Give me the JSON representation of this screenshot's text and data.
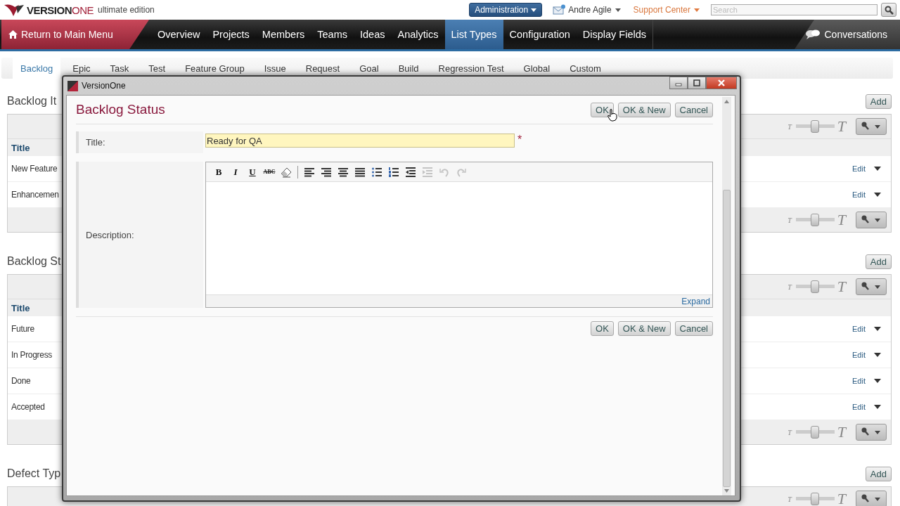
{
  "header": {
    "logo": {
      "brand_main": "VERSION",
      "brand_accent": "ONE",
      "edition": "ultimate edition"
    },
    "admin_menu": "Administration",
    "user": "Andre Agile",
    "support": "Support Center",
    "search": {
      "placeholder": "Search"
    }
  },
  "nav": {
    "return": "Return to Main Menu",
    "items": [
      {
        "label": "Overview",
        "selected": false
      },
      {
        "label": "Projects",
        "selected": false
      },
      {
        "label": "Members",
        "selected": false
      },
      {
        "label": "Teams",
        "selected": false
      },
      {
        "label": "Ideas",
        "selected": false
      },
      {
        "label": "Analytics",
        "selected": false
      },
      {
        "label": "List Types",
        "selected": true
      },
      {
        "label": "Configuration",
        "selected": false
      },
      {
        "label": "Display Fields",
        "selected": false
      }
    ],
    "conversations": "Conversations"
  },
  "subtabs": [
    {
      "label": "Backlog",
      "selected": true
    },
    {
      "label": "Epic",
      "selected": false
    },
    {
      "label": "Task",
      "selected": false
    },
    {
      "label": "Test",
      "selected": false
    },
    {
      "label": "Feature Group",
      "selected": false
    },
    {
      "label": "Issue",
      "selected": false
    },
    {
      "label": "Request",
      "selected": false
    },
    {
      "label": "Goal",
      "selected": false
    },
    {
      "label": "Build",
      "selected": false
    },
    {
      "label": "Regression Test",
      "selected": false
    },
    {
      "label": "Global",
      "selected": false
    },
    {
      "label": "Custom",
      "selected": false
    }
  ],
  "sections": [
    {
      "title": "Backlog It",
      "add": "Add",
      "toolbar_top": {
        "small": "T",
        "large": "T",
        "level": 0.5
      },
      "column": "Title",
      "rows": [
        {
          "title": "New Feature",
          "edit": "Edit"
        },
        {
          "title": "Enhancemen",
          "edit": "Edit"
        }
      ],
      "toolbar_bottom": {
        "small": "T",
        "large": "T",
        "level": 0.5
      }
    },
    {
      "title": "Backlog St",
      "add": "Add",
      "toolbar_top": {
        "small": "T",
        "large": "T",
        "level": 0.5
      },
      "column": "Title",
      "rows": [
        {
          "title": "Future",
          "edit": "Edit"
        },
        {
          "title": "In Progress",
          "edit": "Edit"
        },
        {
          "title": "Done",
          "edit": "Edit"
        },
        {
          "title": "Accepted",
          "edit": "Edit"
        }
      ],
      "toolbar_bottom": {
        "small": "T",
        "large": "T",
        "level": 0.5
      }
    },
    {
      "title": "Defect Typ",
      "add": "Add",
      "toolbar_top": {
        "small": "T",
        "large": "T",
        "level": 0.5
      }
    }
  ],
  "dialog": {
    "window_title": "VersionOne",
    "heading": "Backlog Status",
    "buttons": [
      "OK",
      "OK & New",
      "Cancel"
    ],
    "title_field": {
      "label": "Title:",
      "value": "Ready for QA",
      "required_mark": "*"
    },
    "description": {
      "label": "Description:",
      "expand": "Expand",
      "format_buttons": [
        {
          "kind": "bold",
          "label": "B",
          "disabled": false
        },
        {
          "kind": "italic",
          "label": "I",
          "disabled": false
        },
        {
          "kind": "underline",
          "label": "U",
          "disabled": false
        },
        {
          "kind": "strike",
          "label": "ABC",
          "disabled": false
        },
        {
          "kind": "eraser",
          "disabled": false
        }
      ],
      "paragraph_buttons": [
        {
          "kind": "align-left",
          "disabled": false
        },
        {
          "kind": "align-right",
          "disabled": false
        },
        {
          "kind": "align-center",
          "disabled": false
        },
        {
          "kind": "justify",
          "disabled": false
        },
        {
          "kind": "bullet-list",
          "disabled": false
        },
        {
          "kind": "numbered-list",
          "disabled": false
        },
        {
          "kind": "outdent",
          "disabled": false
        },
        {
          "kind": "indent",
          "disabled": true
        },
        {
          "kind": "undo",
          "disabled": true
        },
        {
          "kind": "redo",
          "disabled": true
        }
      ]
    },
    "bottom_buttons": [
      "OK",
      "OK & New",
      "Cancel"
    ]
  }
}
